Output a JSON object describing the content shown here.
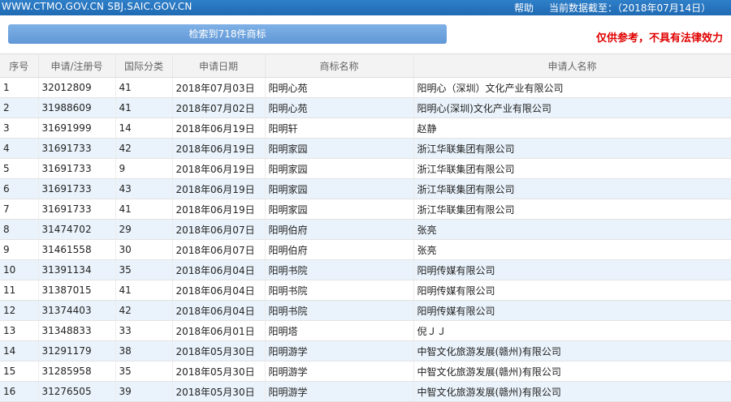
{
  "topbar": {
    "site": "WWW.CTMO.GOV.CN SBJ.SAIC.GOV.CN",
    "help": "帮助",
    "cutoff": "当前数据截至：（2018年07月14日）"
  },
  "banner": {
    "text": "检索到718件商标"
  },
  "disclaimer": "仅供参考，不具有法律效力",
  "table": {
    "headers": [
      "序号",
      "申请/注册号",
      "国际分类",
      "申请日期",
      "商标名称",
      "申请人名称"
    ],
    "rows": [
      [
        "1",
        "32012809",
        "41",
        "2018年07月03日",
        "阳明心苑",
        "阳明心（深圳）文化产业有限公司"
      ],
      [
        "2",
        "31988609",
        "41",
        "2018年07月02日",
        "阳明心苑",
        "阳明心(深圳)文化产业有限公司"
      ],
      [
        "3",
        "31691999",
        "14",
        "2018年06月19日",
        "阳明轩",
        "赵静"
      ],
      [
        "4",
        "31691733",
        "42",
        "2018年06月19日",
        "阳明家园",
        "浙江华联集团有限公司"
      ],
      [
        "5",
        "31691733",
        "9",
        "2018年06月19日",
        "阳明家园",
        "浙江华联集团有限公司"
      ],
      [
        "6",
        "31691733",
        "43",
        "2018年06月19日",
        "阳明家园",
        "浙江华联集团有限公司"
      ],
      [
        "7",
        "31691733",
        "41",
        "2018年06月19日",
        "阳明家园",
        "浙江华联集团有限公司"
      ],
      [
        "8",
        "31474702",
        "29",
        "2018年06月07日",
        "阳明伯府",
        "张亮"
      ],
      [
        "9",
        "31461558",
        "30",
        "2018年06月07日",
        "阳明伯府",
        "张亮"
      ],
      [
        "10",
        "31391134",
        "35",
        "2018年06月04日",
        "阳明书院",
        "阳明传媒有限公司"
      ],
      [
        "11",
        "31387015",
        "41",
        "2018年06月04日",
        "阳明书院",
        "阳明传媒有限公司"
      ],
      [
        "12",
        "31374403",
        "42",
        "2018年06月04日",
        "阳明书院",
        "阳明传媒有限公司"
      ],
      [
        "13",
        "31348833",
        "33",
        "2018年06月01日",
        "阳明塔",
        "倪ＪＪ"
      ],
      [
        "14",
        "31291179",
        "38",
        "2018年05月30日",
        "阳明游学",
        "中智文化旅游发展(赣州)有限公司"
      ],
      [
        "15",
        "31285958",
        "35",
        "2018年05月30日",
        "阳明游学",
        "中智文化旅游发展(赣州)有限公司"
      ],
      [
        "16",
        "31276505",
        "39",
        "2018年05月30日",
        "阳明游学",
        "中智文化旅游发展(赣州)有限公司"
      ]
    ]
  }
}
